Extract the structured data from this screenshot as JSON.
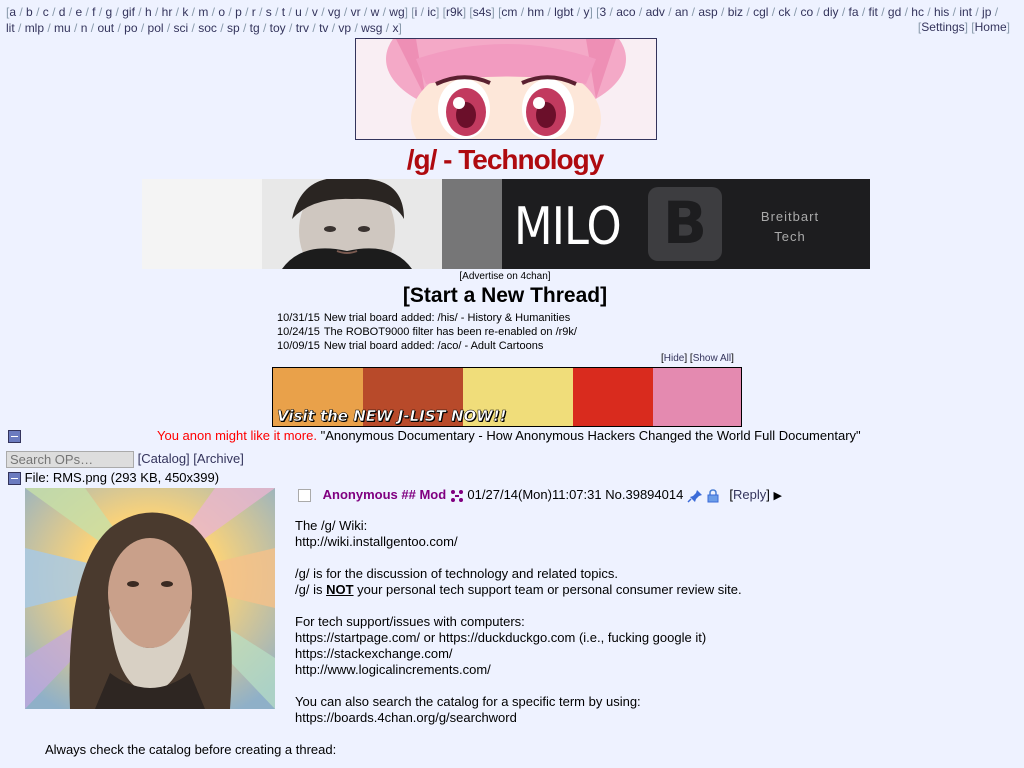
{
  "nav": {
    "group1": [
      "a",
      "b",
      "c",
      "d",
      "e",
      "f",
      "g",
      "gif",
      "h",
      "hr",
      "k",
      "m",
      "o",
      "p",
      "r",
      "s",
      "t",
      "u",
      "v",
      "vg",
      "vr",
      "w",
      "wg"
    ],
    "group2": [
      "i",
      "ic"
    ],
    "group3": [
      "r9k"
    ],
    "group4": [
      "s4s"
    ],
    "group5": [
      "cm",
      "hm",
      "lgbt",
      "y"
    ],
    "group6": [
      "3",
      "aco",
      "adv",
      "an",
      "asp",
      "biz",
      "cgl",
      "ck",
      "co",
      "diy",
      "fa",
      "fit",
      "gd",
      "hc",
      "his",
      "int",
      "jp",
      "lit",
      "mlp",
      "mu",
      "n",
      "out",
      "po",
      "pol",
      "sci",
      "soc",
      "sp",
      "tg",
      "toy",
      "trv",
      "tv",
      "vp",
      "wsg",
      "x"
    ],
    "settings": "Settings",
    "home": "Home"
  },
  "board_title": "/g/ - Technology",
  "ad": {
    "headline": "MILO",
    "logo_letter": "B",
    "brand_line1": "Breitbart",
    "brand_line2": "Tech"
  },
  "advertise_link": "[Advertise on 4chan]",
  "start_thread": "[Start a New Thread]",
  "news": [
    {
      "date": "10/31/15",
      "text": "New trial board added: /his/ - History & Humanities"
    },
    {
      "date": "10/24/15",
      "text": "The ROBOT9000 filter has been re-enabled on /r9k/"
    },
    {
      "date": "10/09/15",
      "text": "New trial board added: /aco/ - Adult Cartoons"
    }
  ],
  "news_controls": {
    "hide": "Hide",
    "show_all": "Show All"
  },
  "jlist_ad": {
    "caption": "Visit the NEW J-LIST NOW!!"
  },
  "global_message": {
    "red": "You anon might like it more.",
    "title": "\"Anonymous Documentary - How Anonymous Hackers Changed the World Full Documentary\""
  },
  "search": {
    "placeholder": "Search OPs…",
    "catalog": "[Catalog]",
    "archive": "[Archive]"
  },
  "op": {
    "file_label": "File:",
    "file_name": "RMS.png",
    "file_meta": "(293 KB, 450x399)",
    "name": "Anonymous",
    "capcode": "## Mod",
    "datetime": "01/27/14(Mon)11:07:31",
    "post_no": "No.39894014",
    "reply": "Reply",
    "body": [
      "The /g/ Wiki:",
      "http://wiki.installgentoo.com/",
      "",
      "/g/ is for the discussion of technology and related topics.",
      "",
      "",
      "For tech support/issues with computers:",
      "https://startpage.com/ or https://duckduckgo.com (i.e., fucking google it)",
      "https://stackexchange.com/",
      "http://www.logicalincrements.com/",
      "",
      "You can also search the catalog for a specific term by using:",
      "https://boards.4chan.org/g/searchword"
    ],
    "line5_pre": "/g/ is ",
    "line5_bold": "NOT",
    "line5_post": " your personal tech support team or personal consumer review site.",
    "after_image": "Always check the catalog before creating a thread:"
  },
  "colors": {
    "background": "#eef2ff",
    "link": "#34345c",
    "title_red": "#af0a0f",
    "name_purple": "#800080"
  }
}
